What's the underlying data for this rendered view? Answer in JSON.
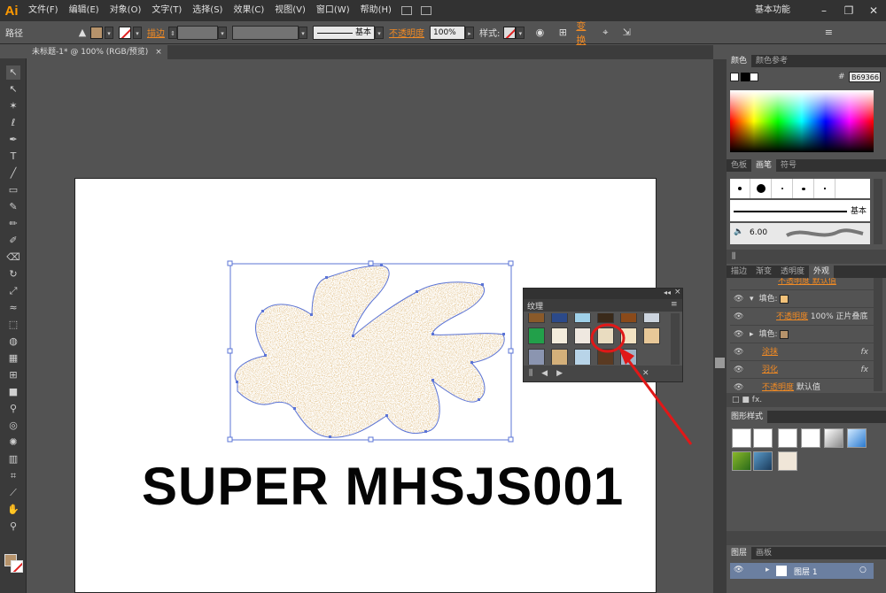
{
  "app": {
    "logo": "Ai",
    "workspace": "基本功能",
    "window_controls": [
      "–",
      "❐",
      "✕"
    ]
  },
  "menu": [
    "文件(F)",
    "编辑(E)",
    "对象(O)",
    "文字(T)",
    "选择(S)",
    "效果(C)",
    "视图(V)",
    "窗口(W)",
    "帮助(H)"
  ],
  "control_bar": {
    "object_type": "路径",
    "stroke_label": "描边",
    "stroke_profile": "基本",
    "opacity_label": "不透明度",
    "opacity_value": "100%",
    "style_label": "样式:",
    "transform_label": "变换",
    "fill_color": "#b6936b"
  },
  "document": {
    "tab_title": "未标题-1* @ 100% (RGB/预览)",
    "tab_close": "×"
  },
  "artwork": {
    "text": "SUPER MHSJS001"
  },
  "texture_panel": {
    "title": "纹理"
  },
  "color_panel": {
    "tabs": [
      "颜色",
      "颜色参考"
    ],
    "hex_label": "#",
    "hex_value": "B69366"
  },
  "brush_panel": {
    "tabs": [
      "色板",
      "画笔",
      "符号"
    ],
    "basic_label": "基本",
    "brush_size": "6.00"
  },
  "appearance_panel": {
    "tabs": [
      "描边",
      "渐变",
      "透明度",
      "外观"
    ],
    "rows": [
      {
        "label": "填色:",
        "swatch": "#f2c27a"
      },
      {
        "label": "不透明度",
        "value": "100% 正片叠底"
      },
      {
        "label": "填色:",
        "swatch": "#b6936b"
      },
      {
        "label": "涂抹",
        "fx": "fx"
      },
      {
        "label": "羽化",
        "fx": "fx"
      },
      {
        "label": "不透明度",
        "value": "默认值"
      }
    ],
    "top_partial": "不透明度 默认值"
  },
  "graphic_styles_panel": {
    "title": "图形样式"
  },
  "layers_panel": {
    "tabs": [
      "图层",
      "画板"
    ],
    "layer_name": "图层 1"
  }
}
